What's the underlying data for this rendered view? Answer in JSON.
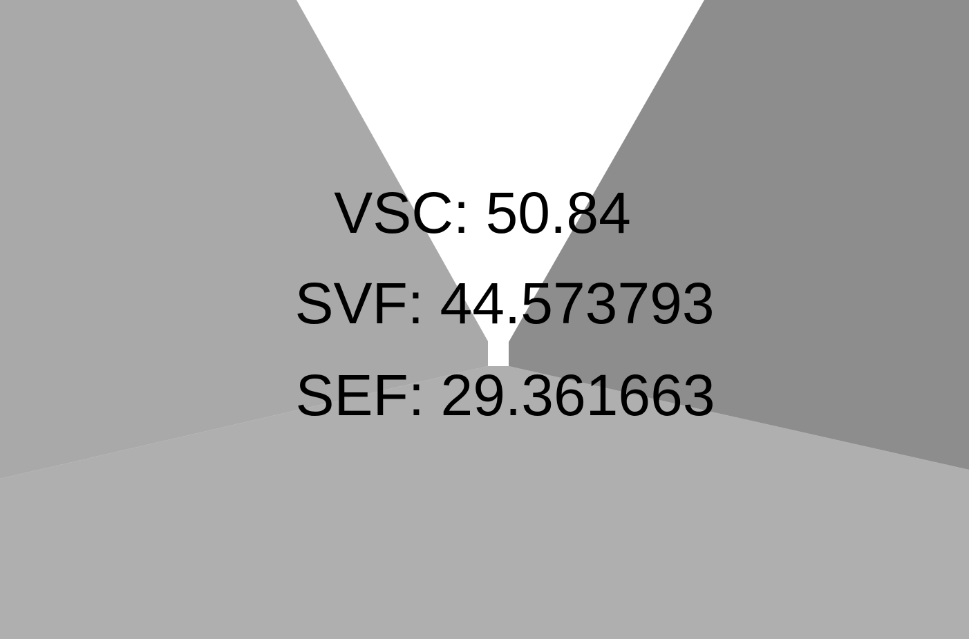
{
  "colors": {
    "sky": "#ffffff",
    "left_wall": "#a9a9a9",
    "right_wall": "#8d8d8d",
    "ground": "#afafaf",
    "far_wall": "#a9a9a9",
    "text": "#000000"
  },
  "metrics": {
    "vsc": "VSC: 50.84",
    "svf": "SVF: 44.573793",
    "sef": "SEF: 29.361663"
  }
}
